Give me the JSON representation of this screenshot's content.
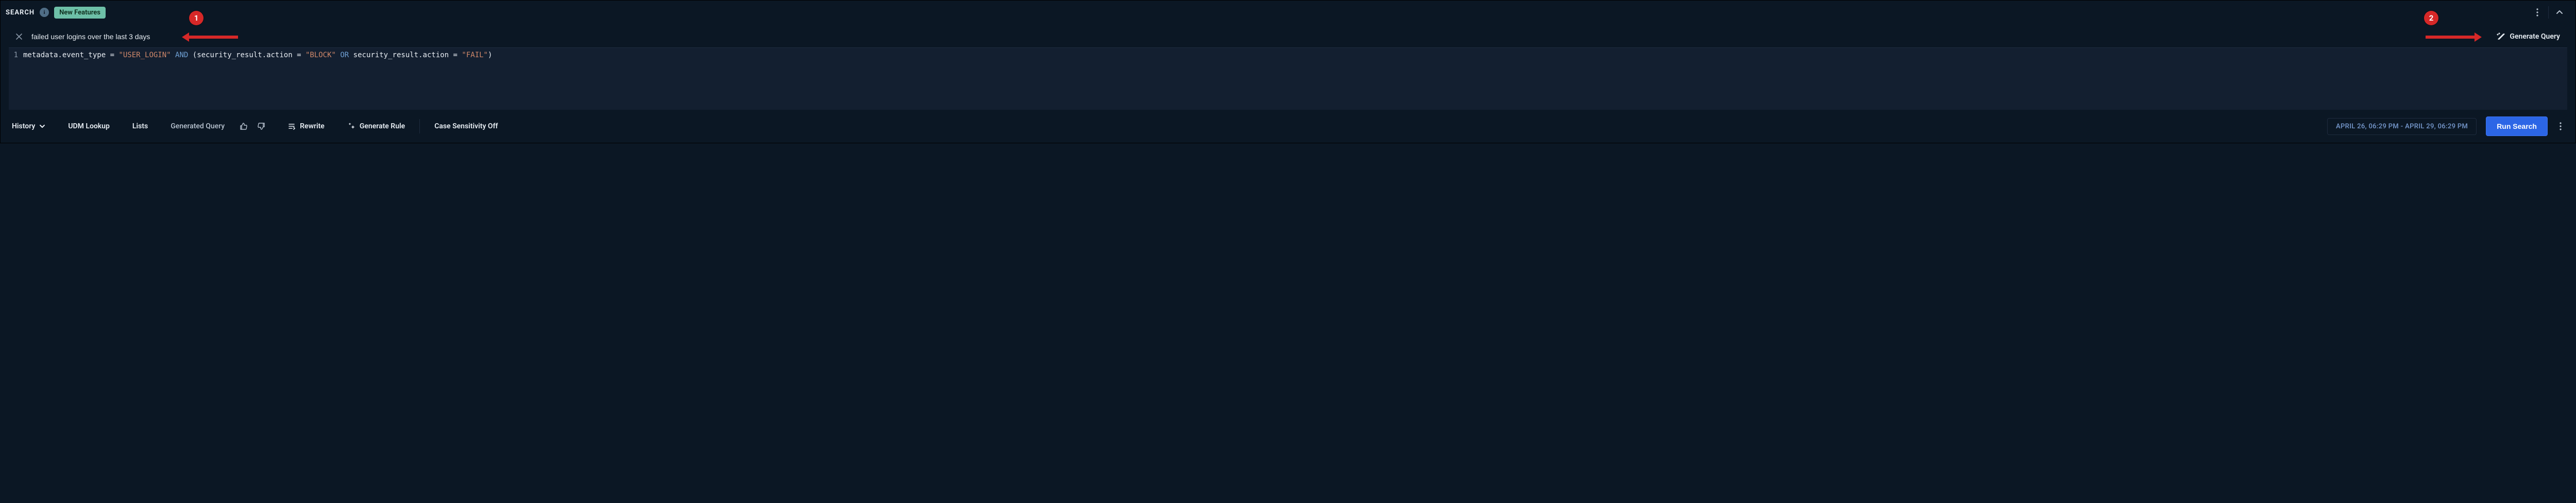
{
  "header": {
    "search_label": "SEARCH",
    "new_features_label": "New Features"
  },
  "nl_query": {
    "value": "failed user logins over the last 3 days",
    "generate_label": "Generate Query"
  },
  "editor": {
    "line_number": "1",
    "tokens": {
      "path1": "metadata.event_type",
      "eq": " = ",
      "str_login": "\"USER_LOGIN\"",
      "and": " AND ",
      "lparen": "(",
      "path2": "security_result.action",
      "str_block": "\"BLOCK\"",
      "or": " OR ",
      "path3": "security_result.action",
      "str_fail": "\"FAIL\"",
      "rparen": ")"
    }
  },
  "toolbar": {
    "history": "History",
    "udm_lookup": "UDM Lookup",
    "lists": "Lists",
    "generated_query": "Generated Query",
    "rewrite": "Rewrite",
    "generate_rule": "Generate Rule",
    "case_sensitivity": "Case Sensitivity Off",
    "time_range": "APRIL 26, 06:29 PM - APRIL 29, 06:29 PM",
    "run_search": "Run Search"
  },
  "callouts": {
    "one": "1",
    "two": "2"
  }
}
